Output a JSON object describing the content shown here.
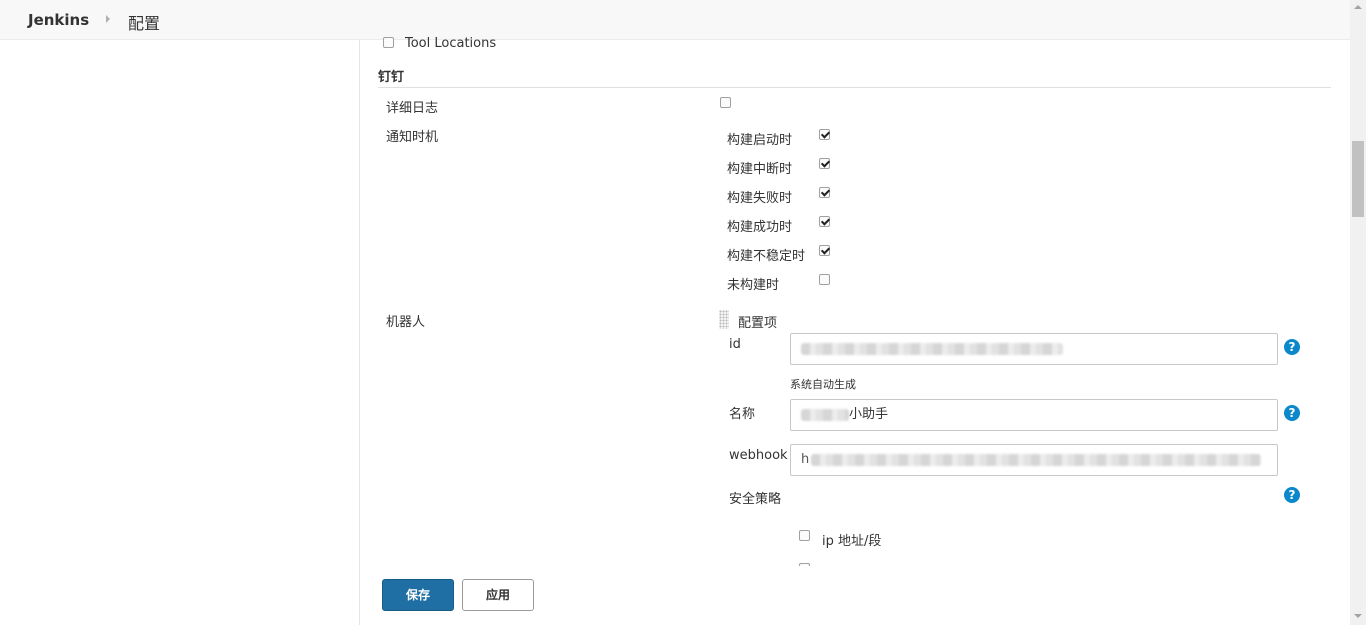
{
  "header": {
    "brand": "Jenkins",
    "breadcrumb": "配置"
  },
  "tool_locations": {
    "label": "Tool Locations",
    "checked": false
  },
  "dingtalk": {
    "section_title": "钉钉",
    "verbose_log": {
      "label": "详细日志",
      "checked": false
    },
    "notify_timing": {
      "label": "通知时机",
      "options": [
        {
          "label": "构建启动时",
          "checked": true
        },
        {
          "label": "构建中断时",
          "checked": true
        },
        {
          "label": "构建失败时",
          "checked": true
        },
        {
          "label": "构建成功时",
          "checked": true
        },
        {
          "label": "构建不稳定时",
          "checked": true
        },
        {
          "label": "未构建时",
          "checked": false
        }
      ]
    },
    "robot": {
      "label": "机器人",
      "config_item_label": "配置项",
      "id_label": "id",
      "id_hint": "系统自动生成",
      "name_label": "名称",
      "name_value_suffix": "小助手",
      "webhook_label": "webhook",
      "webhook_prefix": "h",
      "security_label": "安全策略",
      "ip_option_label": "ip 地址/段"
    }
  },
  "buttons": {
    "save": "保存",
    "apply": "应用"
  },
  "colors": {
    "primary_button": "#1f6fa5",
    "help_icon": "#0b88cc"
  }
}
